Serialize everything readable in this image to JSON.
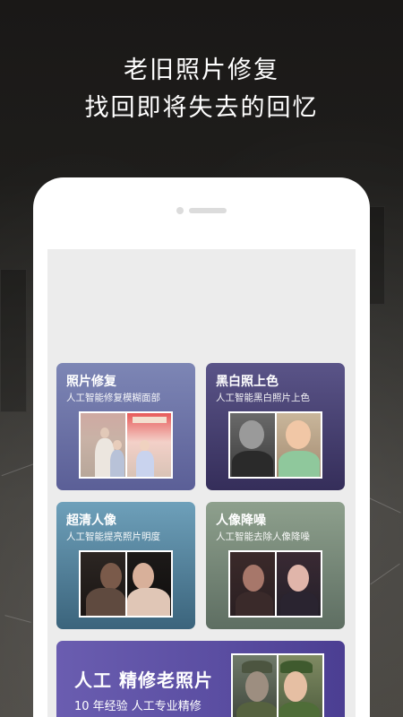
{
  "headline": {
    "line1": "老旧照片修复",
    "line2": "找回即将失去的回忆"
  },
  "cards": [
    {
      "title": "照片修复",
      "subtitle": "人工智能修复模糊面部",
      "icon": "photo-restore"
    },
    {
      "title": "黑白照上色",
      "subtitle": "人工智能黑白照片上色",
      "icon": "colorize"
    },
    {
      "title": "超清人像",
      "subtitle": "人工智能提亮照片明度",
      "icon": "hd-portrait"
    },
    {
      "title": "人像降噪",
      "subtitle": "人工智能去除人像降噪",
      "icon": "denoise"
    }
  ],
  "banner": {
    "title": "人工 精修老照片",
    "subtitle": "10 年经验 人工专业精修"
  },
  "colors": {
    "card1": "#6f78aa",
    "card2": "#453f71",
    "card3": "#55839b",
    "card4": "#768775",
    "banner": "#5b4ea2"
  }
}
